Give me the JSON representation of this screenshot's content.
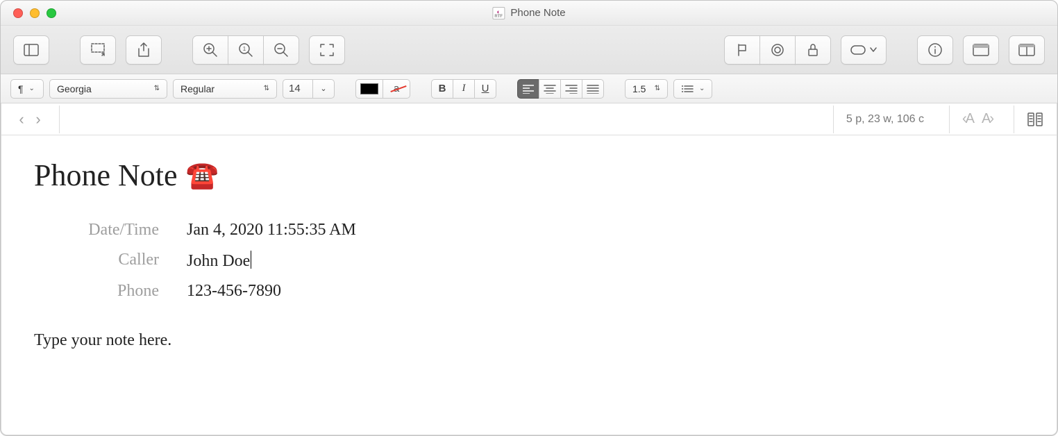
{
  "window": {
    "title": "Phone Note"
  },
  "formatbar": {
    "paragraph_style": "¶",
    "font": "Georgia",
    "style": "Regular",
    "size": "14",
    "line_spacing": "1.5"
  },
  "statusbar": {
    "word_count": "5 p, 23 w, 106 c"
  },
  "document": {
    "title": "Phone Note",
    "title_emoji": "☎️",
    "fields": [
      {
        "label": "Date/Time",
        "value": "Jan 4, 2020 11:55:35 AM"
      },
      {
        "label": "Caller",
        "value": "John Doe"
      },
      {
        "label": "Phone",
        "value": "123-456-7890"
      }
    ],
    "body": "Type your note here."
  }
}
